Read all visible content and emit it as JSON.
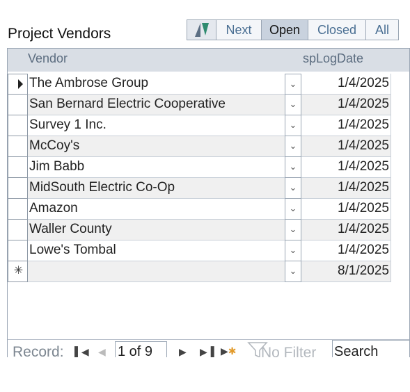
{
  "form": {
    "title": "Project Vendors"
  },
  "tabs": {
    "sort_icon": "sort-toggle-icon",
    "next": "Next",
    "open": "Open",
    "closed": "Closed",
    "all": "All",
    "selected": "Open"
  },
  "columns": {
    "vendor": "Vendor",
    "date": "spLogDate"
  },
  "rows": [
    {
      "vendor": "The Ambrose Group",
      "date": "1/4/2025"
    },
    {
      "vendor": "San Bernard Electric Cooperative",
      "date": "1/4/2025"
    },
    {
      "vendor": "Survey 1 Inc.",
      "date": "1/4/2025"
    },
    {
      "vendor": "McCoy's",
      "date": "1/4/2025"
    },
    {
      "vendor": "Jim Babb",
      "date": "1/4/2025"
    },
    {
      "vendor": "MidSouth Electric Co-Op",
      "date": "1/4/2025"
    },
    {
      "vendor": "Amazon",
      "date": "1/4/2025"
    },
    {
      "vendor": "Waller County",
      "date": "1/4/2025"
    },
    {
      "vendor": "Lowe's Tombal",
      "date": "1/4/2025"
    }
  ],
  "new_row": {
    "vendor": "",
    "date": "8/1/2025",
    "marker": "✳"
  },
  "navigation": {
    "label": "Record:",
    "position": "1 of 9",
    "filter_label": "No Filter",
    "search": "Search"
  },
  "colors": {
    "accent_tab": "#c9d2de",
    "header_bg": "#d9dee5",
    "alt_row": "#f0f0f0",
    "sort_icon_green": "#2e8b6f"
  }
}
